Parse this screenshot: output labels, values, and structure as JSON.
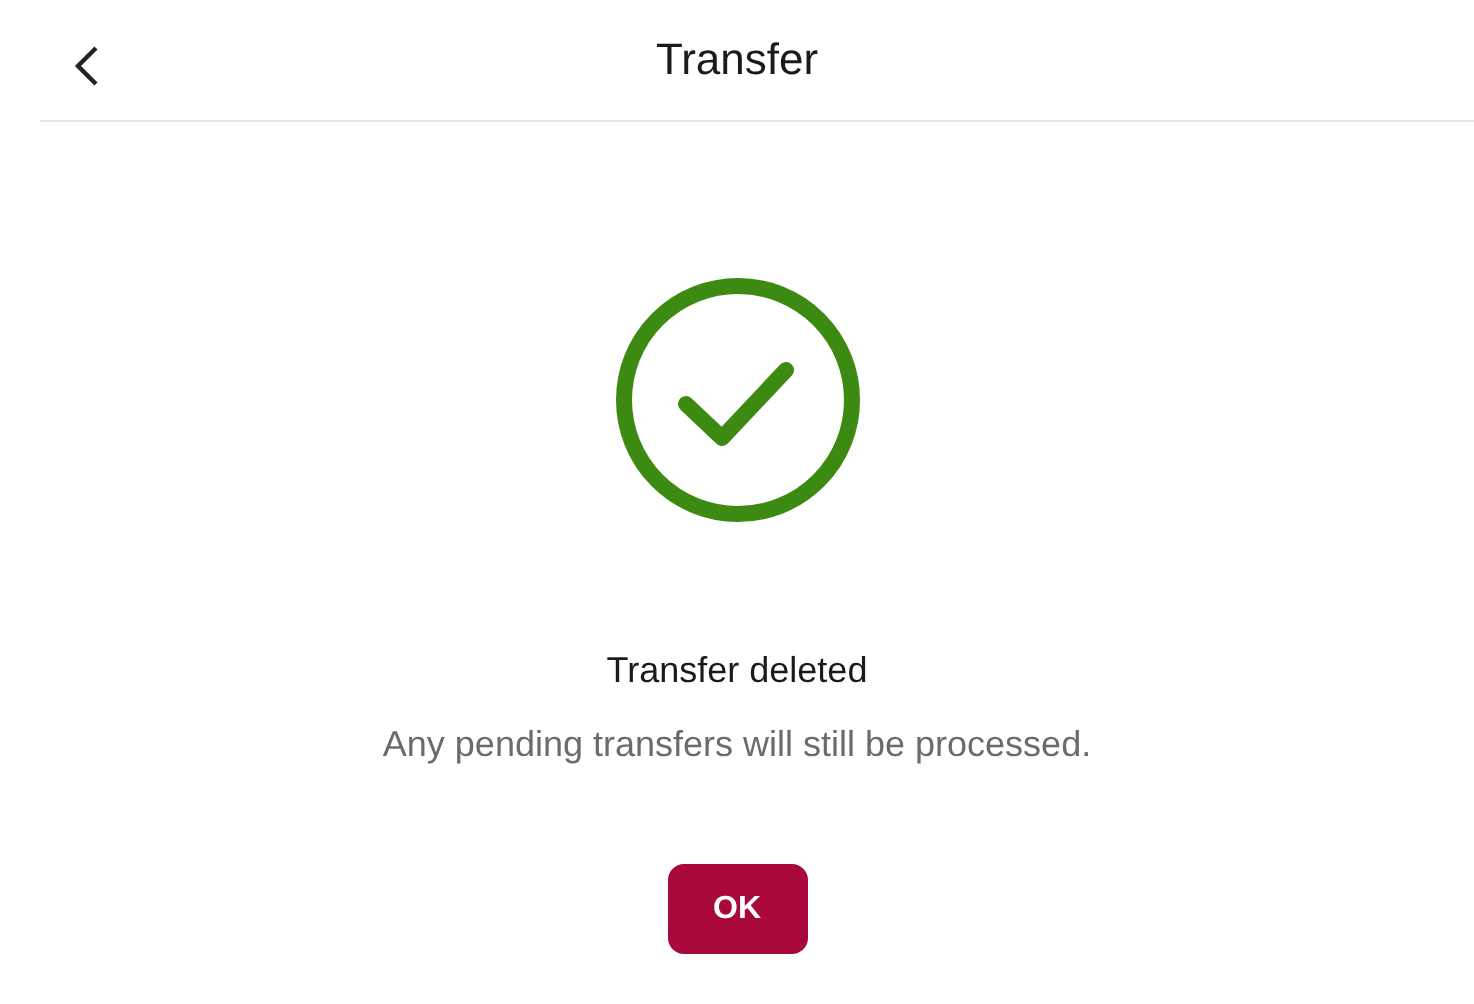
{
  "header": {
    "title": "Transfer"
  },
  "result": {
    "title": "Transfer deleted",
    "message": "Any pending transfers will still be processed."
  },
  "buttons": [
    {
      "label": "OK"
    }
  ]
}
